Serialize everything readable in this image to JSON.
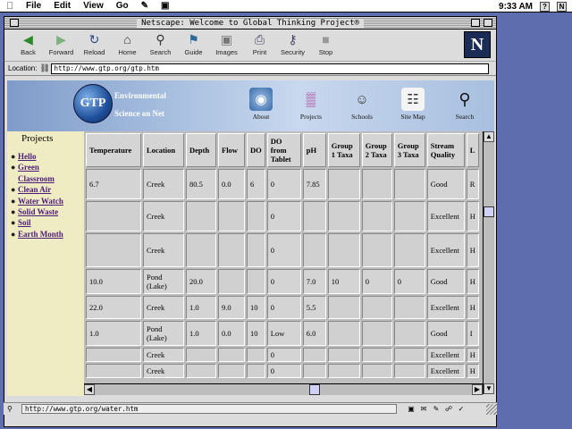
{
  "menubar": {
    "items": [
      "File",
      "Edit",
      "View",
      "Go"
    ],
    "clock": "9:33 AM"
  },
  "window": {
    "title": "Netscape: Welcome to Global Thinking Project®"
  },
  "toolbar": {
    "buttons": [
      {
        "label": "Back",
        "icon": "back-arrow-icon"
      },
      {
        "label": "Forward",
        "icon": "forward-arrow-icon"
      },
      {
        "label": "Reload",
        "icon": "reload-icon"
      },
      {
        "label": "Home",
        "icon": "home-icon"
      },
      {
        "label": "Search",
        "icon": "search-icon"
      },
      {
        "label": "Guide",
        "icon": "guide-icon"
      },
      {
        "label": "Images",
        "icon": "images-icon"
      },
      {
        "label": "Print",
        "icon": "print-icon"
      },
      {
        "label": "Security",
        "icon": "security-icon"
      },
      {
        "label": "Stop",
        "icon": "stop-icon"
      }
    ],
    "logo": "N"
  },
  "location": {
    "label": "Location:",
    "url": "http://www.gtp.org/gtp.htm"
  },
  "banner": {
    "logo_text": "GTP",
    "tagline1": "Environmental",
    "tagline2": "Science on Net",
    "nav": [
      "About",
      "Projects",
      "Schools",
      "Site Map",
      "Search"
    ]
  },
  "sidebar": {
    "title": "Projects",
    "items": [
      {
        "label": "Hello"
      },
      {
        "label": "Green"
      },
      {
        "label": "Classroom"
      },
      {
        "label": "Clean Air"
      },
      {
        "label": "Water Watch"
      },
      {
        "label": "Solid Waste"
      },
      {
        "label": "Soil"
      },
      {
        "label": "Earth Month"
      }
    ]
  },
  "table": {
    "headers": [
      "Temperature",
      "Location",
      "Depth",
      "Flow",
      "DO",
      "DO from Tablet",
      "pH",
      "Group 1 Taxa",
      "Group 2 Taxa",
      "Group 3 Taxa",
      "Stream Quality",
      "L"
    ],
    "rows": [
      [
        "6.7",
        "Creek",
        "80.5",
        "0.0",
        "6",
        "0",
        "7.85",
        "",
        "",
        "",
        "Good",
        "R"
      ],
      [
        "",
        "Creek",
        "",
        "",
        "",
        "0",
        "",
        "",
        "",
        "",
        "Excellent",
        "H"
      ],
      [
        "",
        "Creek",
        "",
        "",
        "",
        "0",
        "",
        "",
        "",
        "",
        "Excellent",
        "H"
      ],
      [
        "10.0",
        "Pond (Lake)",
        "20.0",
        "",
        "",
        "0",
        "7.0",
        "10",
        "0",
        "0",
        "Good",
        "H"
      ],
      [
        "22.0",
        "Creek",
        "1.0",
        "9.0",
        "10",
        "0",
        "5.5",
        "",
        "",
        "",
        "Excellent",
        "H"
      ],
      [
        "1.0",
        "Pond (Lake)",
        "1.0",
        "0.0",
        "10",
        "Low",
        "6.0",
        "",
        "",
        "",
        "Good",
        "I"
      ],
      [
        "",
        "Creek",
        "",
        "",
        "",
        "0",
        "",
        "",
        "",
        "",
        "Excellent",
        "H"
      ],
      [
        "",
        "Creek",
        "",
        "",
        "",
        "0",
        "",
        "",
        "",
        "",
        "Excellent",
        "H"
      ]
    ]
  },
  "status": {
    "message": "http://www.gtp.org/water.htm"
  }
}
